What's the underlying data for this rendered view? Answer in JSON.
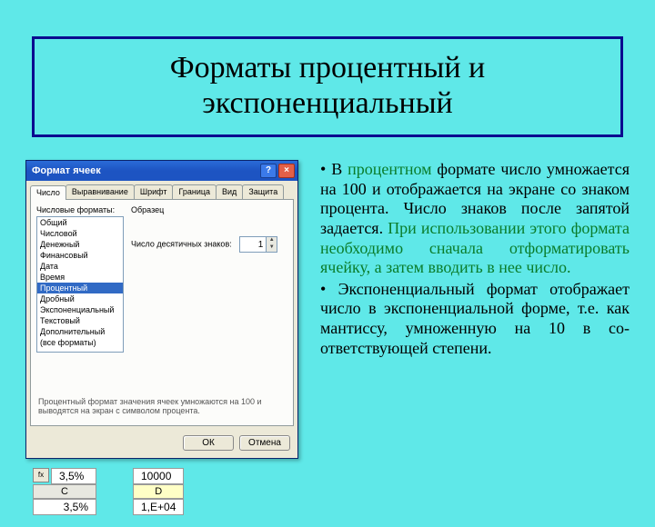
{
  "slide": {
    "title": "Форматы процентный и экспоненциальный"
  },
  "body": {
    "p1_prefix": "•  В ",
    "p1_green": "процентном",
    "p1_rest": " формате число умножается на 100 и отображается на экране со знаком процента. Число знаков после запятой задается. ",
    "p1_green2": "При использовании этого формата необходимо сначала отформа­тировать ячейку, а затем вво­дить в нее число.",
    "p2": "• Экспоненциальный формат отображает число в экспонен­циальной форме, т.е. как ман­тиссу, умноженную на 10 в со­ответствующей степени."
  },
  "dialog": {
    "title": "Формат ячеек",
    "help": "?",
    "close": "×",
    "tabs": [
      "Число",
      "Выравнивание",
      "Шрифт",
      "Граница",
      "Вид",
      "Защита"
    ],
    "list_label": "Числовые форматы:",
    "sample_label": "Образец",
    "decimals_label": "Число десятичных знаков:",
    "decimals_value": "1",
    "formats": [
      "Общий",
      "Числовой",
      "Денежный",
      "Финансовый",
      "Дата",
      "Время",
      "Процентный",
      "Дробный",
      "Экспоненциальный",
      "Текстовый",
      "Дополнительный",
      "(все форматы)"
    ],
    "selected_index": 6,
    "hint": "Процентный формат значения ячеек умножаются на 100 и выводятся на экран с символом процента.",
    "ok": "ОК",
    "cancel": "Отмена"
  },
  "samples": {
    "left": {
      "icon": "fx",
      "v1": "3,5%",
      "hdr": "C",
      "v2": "3,5%"
    },
    "right": {
      "v1": "10000",
      "hdr": "D",
      "v2": "1,E+04"
    }
  }
}
